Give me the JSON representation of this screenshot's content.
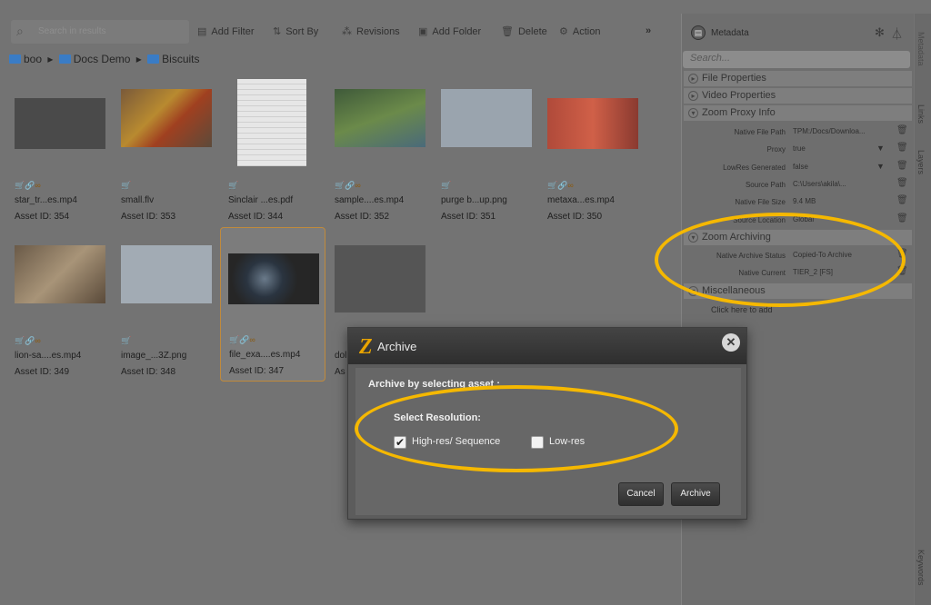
{
  "toolbar": {
    "search_placeholder": "Search in results",
    "add_filter": "Add Filter",
    "sort_by": "Sort By",
    "revisions": "Revisions",
    "add_folder": "Add Folder",
    "delete": "Delete",
    "action": "Action",
    "more": "»"
  },
  "breadcrumb": [
    "boo",
    "Docs Demo",
    "Biscuits"
  ],
  "breadcrumb_sep": "▸",
  "assets": [
    {
      "name": "star_tr...es.mp4",
      "id": "Asset ID: 354",
      "icons": "🛒🔗∞"
    },
    {
      "name": "small.flv",
      "id": "Asset ID: 353",
      "icons": "🛒"
    },
    {
      "name": "Sinclair ...es.pdf",
      "id": "Asset ID: 344",
      "icons": "🛒"
    },
    {
      "name": "sample....es.mp4",
      "id": "Asset ID: 352",
      "icons": "🛒🔗∞"
    },
    {
      "name": "purge b...up.png",
      "id": "Asset ID: 351",
      "icons": "🛒"
    },
    {
      "name": "metaxa...es.mp4",
      "id": "Asset ID: 350",
      "icons": "🛒🔗∞"
    },
    {
      "name": "lion-sa....es.mp4",
      "id": "Asset ID: 349",
      "icons": "🛒🔗∞"
    },
    {
      "name": "image_...3Z.png",
      "id": "Asset ID: 348",
      "icons": "🛒"
    },
    {
      "name": "file_exa....es.mp4",
      "id": "Asset ID: 347",
      "icons": "🛒🔗∞"
    },
    {
      "name": "dol",
      "id": "As",
      "icons": ""
    }
  ],
  "panel": {
    "title": "Metadata",
    "search_placeholder": "Search...",
    "sections": {
      "file_props": "File Properties",
      "video_props": "Video Properties",
      "zoom_proxy": "Zoom Proxy Info",
      "zoom_archiving": "Zoom Archiving",
      "misc": "Miscellaneous"
    },
    "rows": [
      {
        "k": "Native File Path",
        "v": "TPM:/Docs/Downloa..."
      },
      {
        "k": "Proxy",
        "v": "true"
      },
      {
        "k": "LowRes Generated",
        "v": "false"
      },
      {
        "k": "Source Path",
        "v": "C:\\Users\\akila\\..."
      },
      {
        "k": "Native File Size",
        "v": "9.4 MB"
      },
      {
        "k": "Source Location",
        "v": "Global"
      },
      {
        "k": "Native Archive Status",
        "v": "Copied-To Archive"
      },
      {
        "k": "Native Current",
        "v": "TIER_2 [FS]"
      }
    ],
    "add_link": "Click here to add"
  },
  "vtabs": [
    "Metadata",
    "Links",
    "Layers",
    "Keywords"
  ],
  "dialog": {
    "logo": "Z",
    "title": "Archive",
    "close": "✕",
    "subtitle": "Archive by selecting asset :",
    "resolution_label": "Select Resolution:",
    "highres_label": "High-res/ Sequence",
    "highres_checked": true,
    "lowres_label": "Low-res",
    "lowres_checked": false,
    "cancel": "Cancel",
    "archive": "Archive"
  },
  "colors": {
    "highlight": "#f5b800",
    "folder": "#3a7cc5",
    "accent": "#e9a400"
  }
}
